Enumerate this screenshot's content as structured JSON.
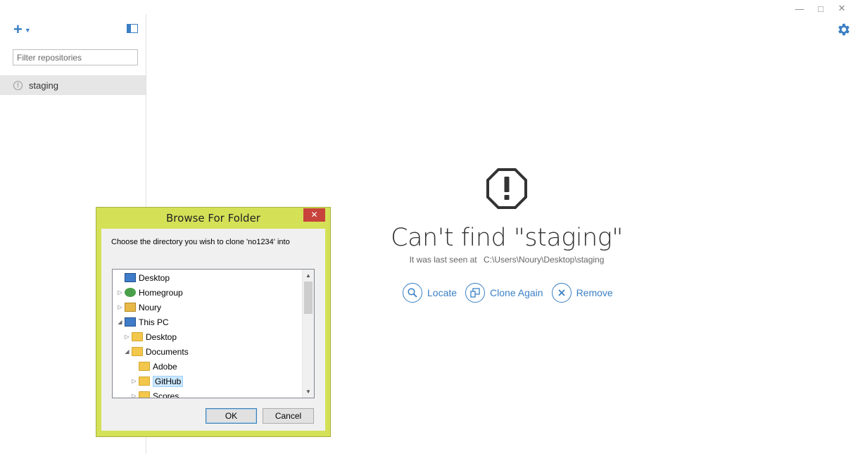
{
  "window": {
    "minimize_glyph": "—",
    "maximize_glyph": "□",
    "close_glyph": "✕"
  },
  "sidebar": {
    "filter_placeholder": "Filter repositories",
    "repositories": [
      {
        "label": "staging",
        "status_icon": "warning-circle-icon"
      }
    ]
  },
  "main": {
    "title": "Can't find \"staging\"",
    "last_seen_label": "It was last seen at",
    "last_seen_path": "C:\\Users\\Noury\\Desktop\\staging",
    "actions": [
      {
        "label": "Locate",
        "icon": "search-icon"
      },
      {
        "label": "Clone Again",
        "icon": "clone-icon"
      },
      {
        "label": "Remove",
        "icon": "close-icon"
      }
    ]
  },
  "dialog": {
    "title": "Browse For Folder",
    "close_glyph": "✕",
    "message": "Choose the directory you wish to clone 'no1234' into",
    "tree": [
      {
        "label": "Desktop",
        "icon": "desktop-icon",
        "expander": ""
      },
      {
        "label": "Homegroup",
        "icon": "homegroup-icon",
        "expander": "▷"
      },
      {
        "label": "Noury",
        "icon": "user-folder-icon",
        "expander": "▷"
      },
      {
        "label": "This PC",
        "icon": "computer-icon",
        "expander": "◢"
      },
      {
        "label": "Desktop",
        "icon": "desktop-folder-icon",
        "expander": "▷"
      },
      {
        "label": "Documents",
        "icon": "documents-folder-icon",
        "expander": "◢"
      },
      {
        "label": "Adobe",
        "icon": "folder-icon",
        "expander": ""
      },
      {
        "label": "GitHub",
        "icon": "folder-icon",
        "expander": "▷",
        "selected": true
      },
      {
        "label": "Scores",
        "icon": "folder-icon",
        "expander": "▷"
      }
    ],
    "ok_label": "OK",
    "cancel_label": "Cancel"
  },
  "colors": {
    "accent": "#3a7fc4",
    "dialog_frame": "#d4e157",
    "close_red": "#c7433b"
  }
}
